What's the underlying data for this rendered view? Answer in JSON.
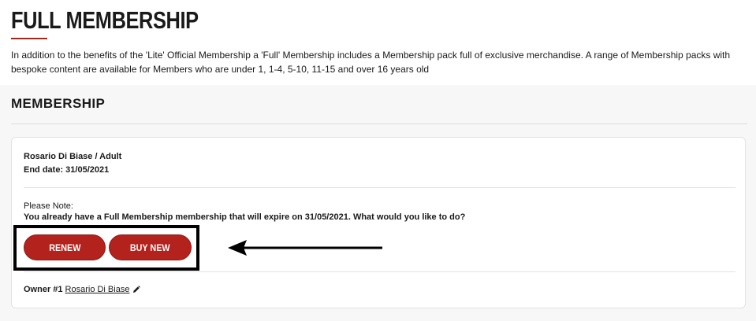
{
  "header": {
    "title": "FULL MEMBERSHIP",
    "intro": "In addition to the benefits of the 'Lite' Official Membership a 'Full' Membership includes a Membership pack full of exclusive merchandise. A range of Membership packs with bespoke content are available for Members who are under 1, 1-4, 5-10, 11-15 and over 16 years old"
  },
  "section": {
    "title": "MEMBERSHIP"
  },
  "card": {
    "member": "Rosario Di Biase  / Adult",
    "end_date": "End date: 31/05/2021",
    "note_label": "Please Note:",
    "note_text": "You already have a Full Membership membership that will expire on 31/05/2021. What would you like to do?",
    "renew_label": "RENEW",
    "buy_new_label": "BUY NEW",
    "owner_label": "Owner #1",
    "owner_name": "Rosario Di Biase",
    "owner_edit_icon": "pencil-icon"
  },
  "colors": {
    "accent": "#b3221c",
    "title_underline": "#9b2a1f",
    "section_bg": "#f7f7f7"
  }
}
